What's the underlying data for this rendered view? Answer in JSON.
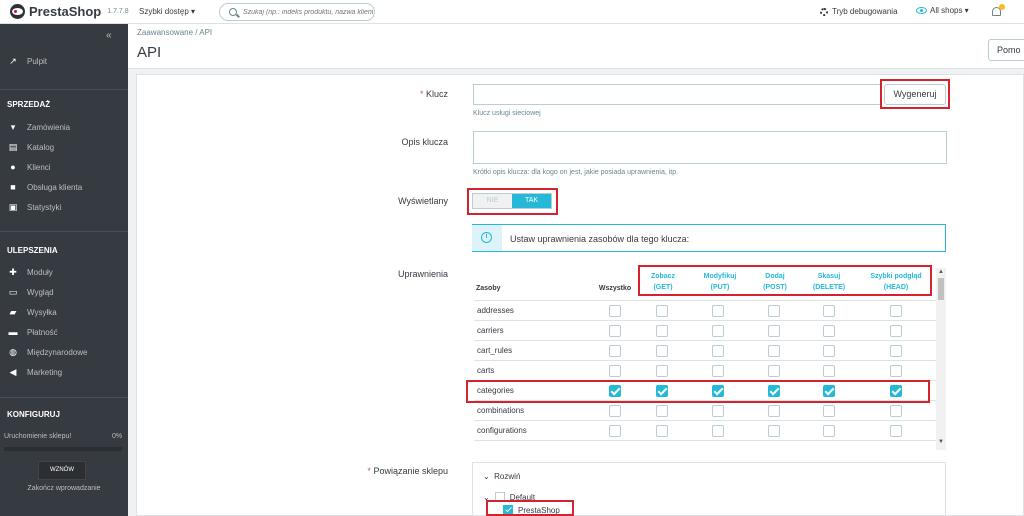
{
  "app": {
    "name": "PrestaShop",
    "version": "1.7.7.8"
  },
  "topbar": {
    "quick_access": "Szybki dostęp ▾",
    "search_placeholder": "Szukaj (np.: indeks produktu, nazwa klienta",
    "debug_label": "Tryb debugowania",
    "shops_label": "All shops ▾"
  },
  "sidebar": {
    "collapse_icon": "«",
    "dashboard": "Pulpit",
    "section_sales": "SPRZEDAŻ",
    "sales_items": [
      "Zamówienia",
      "Katalog",
      "Klienci",
      "Obsługa klienta",
      "Statystyki"
    ],
    "section_improve": "ULEPSZENIA",
    "improve_items": [
      "Moduły",
      "Wygląd",
      "Wysyłka",
      "Płatność",
      "Międzynarodowe",
      "Marketing"
    ],
    "section_configure": "KONFIGURUJ",
    "onboarding_label": "Uruchomienie sklepu!",
    "onboarding_percent": "0%",
    "onboarding_progress": 0,
    "resume_button": "WZNÓW",
    "finish_link": "Zakończ wprowadzanie"
  },
  "header": {
    "breadcrumb": "Zaawansowane  /  API",
    "title": "API",
    "help_button": "Pomo"
  },
  "form": {
    "key_label": "Klucz",
    "key_required": "*",
    "key_value": "",
    "generate_button": "Wygeneruj",
    "key_help": "Klucz usługi sieciowej",
    "desc_label": "Opis klucza",
    "desc_value": "",
    "desc_help": "Krótki opis klucza: dla kogo on jest, jakie posiada uprawnienia, itp.",
    "enabled_label": "Wyświetlany",
    "enabled_no": "NIE",
    "enabled_yes": "TAK",
    "info_text": "Ustaw uprawnienia zasobów dla tego klucza:",
    "permissions_label": "Uprawnienia",
    "shop_label": "Powiązanie sklepu",
    "shop_required": "*"
  },
  "permissions": {
    "col_resource": "Zasoby",
    "col_all": "Wszystko",
    "columns": [
      {
        "name": "Zobacz",
        "method": "(GET)"
      },
      {
        "name": "Modyfikuj",
        "method": "(PUT)"
      },
      {
        "name": "Dodaj",
        "method": "(POST)"
      },
      {
        "name": "Skasuj",
        "method": "(DELETE)"
      },
      {
        "name": "Szybki podgląd",
        "method": "(HEAD)"
      }
    ],
    "rows": [
      {
        "name": "addresses",
        "checked": [
          false,
          false,
          false,
          false,
          false,
          false
        ]
      },
      {
        "name": "carriers",
        "checked": [
          false,
          false,
          false,
          false,
          false,
          false
        ]
      },
      {
        "name": "cart_rules",
        "checked": [
          false,
          false,
          false,
          false,
          false,
          false
        ]
      },
      {
        "name": "carts",
        "checked": [
          false,
          false,
          false,
          false,
          false,
          false
        ]
      },
      {
        "name": "categories",
        "checked": [
          true,
          true,
          true,
          true,
          true,
          true
        ]
      },
      {
        "name": "combinations",
        "checked": [
          false,
          false,
          false,
          false,
          false,
          false
        ]
      },
      {
        "name": "configurations",
        "checked": [
          false,
          false,
          false,
          false,
          false,
          false
        ]
      }
    ]
  },
  "shop_tree": {
    "expand_label": "Rozwiń",
    "group": "Default",
    "shop": "PrestaShop",
    "shop_checked": true
  },
  "colors": {
    "accent": "#25b9d7",
    "sidebar": "#363a41",
    "highlight": "#d5232d"
  }
}
